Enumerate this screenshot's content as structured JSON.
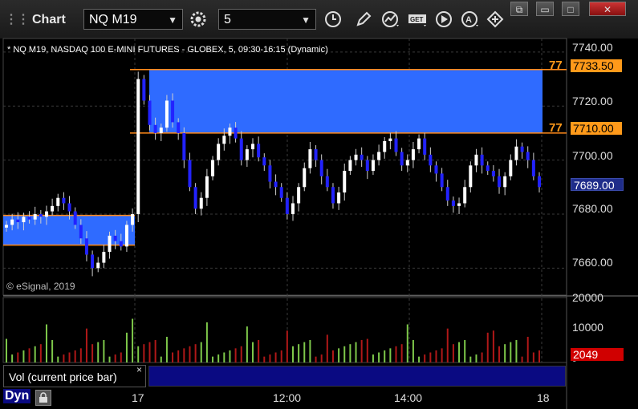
{
  "app": {
    "title": "Chart"
  },
  "toolbar": {
    "symbol": "NQ M19",
    "interval": "5",
    "icons": [
      "gear-icon",
      "clock-icon",
      "pencil-icon",
      "study-icon",
      "get-icon",
      "play-icon",
      "alert-icon",
      "layout-icon"
    ]
  },
  "window": {
    "buttons": [
      "restore-icon",
      "minimize-icon",
      "maximize-icon",
      "close-icon"
    ]
  },
  "chart": {
    "ticker_line": "* NQ M19, NASDAQ 100 E-MINI FUTURES - GLOBEX, 5, 09:30-16:15 (Dynamic)",
    "copyright": "© eSignal, 2019",
    "price_axis": [
      "7740.00",
      "7720.00",
      "7700.00",
      "7680.00",
      "7660.00"
    ],
    "zone_labels": [
      "77",
      "77"
    ],
    "badges": {
      "top": "7733.50",
      "mid": "7710.00",
      "last": "7689.00"
    },
    "colors": {
      "zone_fill": "#2f6bff",
      "zone_line": "#ff8a1a",
      "up": "#ffffff",
      "down": "#2222ff",
      "vol_up": "#7ec84a",
      "vol_down": "#b01818"
    }
  },
  "volume": {
    "axis": [
      "20000",
      "10000",
      "0"
    ],
    "last_badge": "2049",
    "legend": "Vol (current price bar)",
    "close_glyph": "×"
  },
  "time_axis": [
    "17",
    "12:00",
    "14:00",
    "18"
  ],
  "footer": {
    "mode": "Dyn"
  },
  "chart_data": {
    "type": "candlestick",
    "title": "* NQ M19, NASDAQ 100 E-MINI FUTURES - GLOBEX, 5, 09:30-16:15 (Dynamic)",
    "ylim": [
      7650,
      7745
    ],
    "zones": [
      {
        "from": 7710.0,
        "to": 7733.5
      },
      {
        "from": 7668.5,
        "to": 7679.5
      }
    ],
    "closes": [
      7676,
      7678,
      7677,
      7679,
      7678,
      7680,
      7679,
      7681,
      7683,
      7686,
      7684,
      7681,
      7676,
      7671,
      7665,
      7660,
      7662,
      7666,
      7672,
      7670,
      7668,
      7676,
      7680,
      7730,
      7722,
      7713,
      7710,
      7712,
      7722,
      7714,
      7710,
      7700,
      7690,
      7682,
      7686,
      7694,
      7700,
      7706,
      7709,
      7712,
      7708,
      7700,
      7704,
      7706,
      7701,
      7698,
      7692,
      7690,
      7686,
      7680,
      7684,
      7690,
      7697,
      7704,
      7700,
      7694,
      7690,
      7684,
      7688,
      7696,
      7700,
      7702,
      7700,
      7696,
      7700,
      7703,
      7707,
      7708,
      7703,
      7698,
      7700,
      7704,
      7708,
      7702,
      7698,
      7695,
      7690,
      7685,
      7683,
      7684,
      7690,
      7698,
      7702,
      7698,
      7696,
      7694,
      7690,
      7694,
      7700,
      7705,
      7703,
      7700,
      7694,
      7690
    ]
  }
}
